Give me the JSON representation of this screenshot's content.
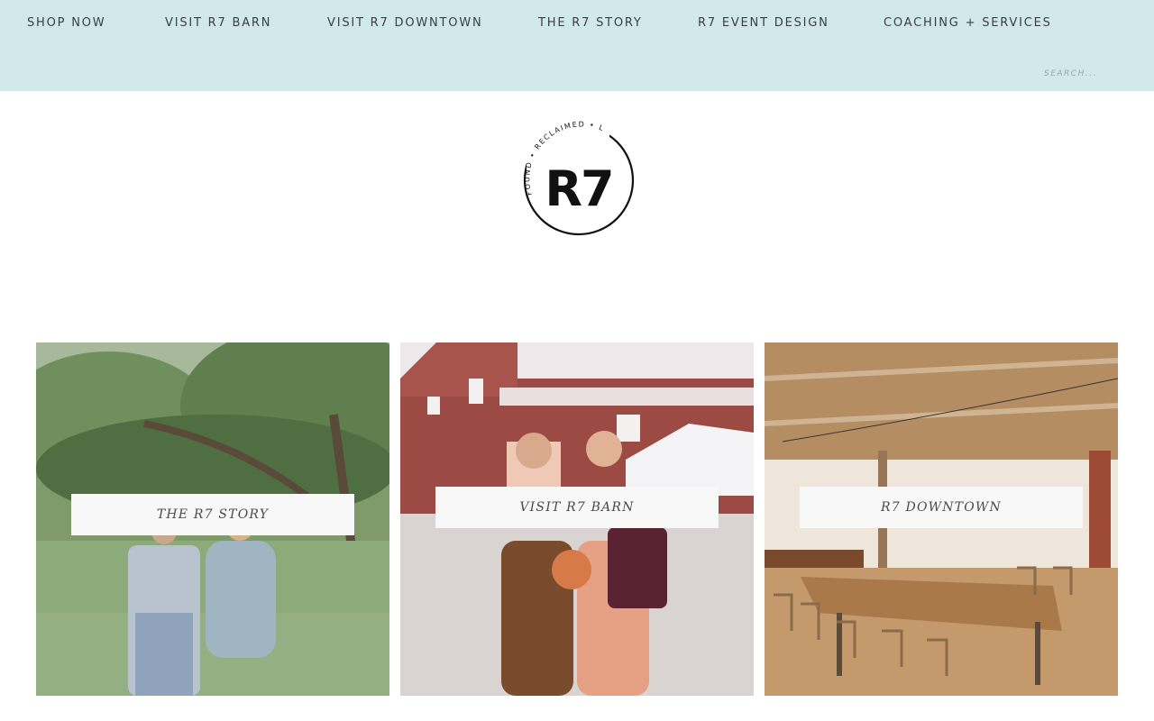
{
  "nav": {
    "items": [
      {
        "label": "SHOP NOW"
      },
      {
        "label": "VISIT R7 BARN"
      },
      {
        "label": "VISIT R7 DOWNTOWN"
      },
      {
        "label": "THE R7 STORY"
      },
      {
        "label": "R7 EVENT DESIGN"
      },
      {
        "label": "COACHING + SERVICES"
      }
    ]
  },
  "search": {
    "placeholder": "SEARCH..."
  },
  "logo": {
    "monogram": "R7",
    "ring_text": "FOUND • RECLAIMED • LOVED"
  },
  "tiles": [
    {
      "label": "THE R7 STORY"
    },
    {
      "label": "VISIT R7 BARN"
    },
    {
      "label": "R7 DOWNTOWN"
    }
  ],
  "colors": {
    "header_bg": "#d2e9eb",
    "nav_text": "#3a3f44",
    "label_bg": "#f8f8f8"
  }
}
